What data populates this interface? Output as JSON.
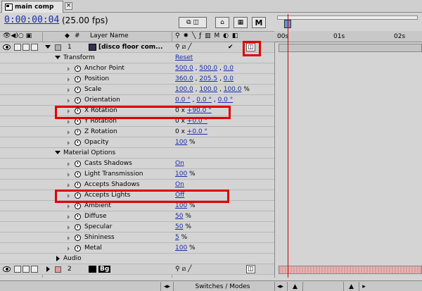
{
  "window": {
    "tab_title": "main comp",
    "close_glyph": "×"
  },
  "header": {
    "timecode": "0:00:00:04",
    "fps": "(25.00 fps)",
    "mode_button": "M"
  },
  "columns": {
    "hash": "#",
    "layer_name": "Layer Name"
  },
  "timeline": {
    "ticks": [
      "00s",
      "01s",
      "02s"
    ],
    "playhead_time": "0:00:00:04"
  },
  "layers": [
    {
      "num": "1",
      "name": "[disco floor com...",
      "label_color": "#b0b0b0",
      "bar_color": "#c4c4c4"
    },
    {
      "num": "2",
      "name": "Bg",
      "label_color": "#e89a9a",
      "bar_color": "#d9a0a0"
    }
  ],
  "transform": {
    "group": "Transform",
    "reset": "Reset",
    "props": [
      {
        "name": "Anchor Point",
        "value": [
          "500.0",
          " , ",
          "500.0",
          " , ",
          "0.0"
        ]
      },
      {
        "name": "Position",
        "value": [
          "360.0",
          " , ",
          "205.5",
          " , ",
          "0.0"
        ]
      },
      {
        "name": "Scale",
        "value": [
          "100.0",
          " , ",
          "100.0",
          " , ",
          "100.0",
          " %"
        ]
      },
      {
        "name": "Orientation",
        "value": [
          "0.0 °",
          " , ",
          "0.0 °",
          " , ",
          "0.0 °"
        ]
      },
      {
        "name": "X Rotation",
        "value": [
          "0 x ",
          "+90.0 °"
        ]
      },
      {
        "name": "Y Rotation",
        "value": [
          "0 x ",
          "+0.0 °"
        ]
      },
      {
        "name": "Z Rotation",
        "value": [
          "0 x ",
          "+0.0 °"
        ]
      },
      {
        "name": "Opacity",
        "value": [
          "100",
          " %"
        ]
      }
    ]
  },
  "material": {
    "group": "Material Options",
    "props": [
      {
        "name": "Casts Shadows",
        "value": [
          "On"
        ]
      },
      {
        "name": "Light Transmission",
        "value": [
          "100",
          " %"
        ]
      },
      {
        "name": "Accepts Shadows",
        "value": [
          "On"
        ]
      },
      {
        "name": "Accepts Lights",
        "value": [
          "Off"
        ]
      },
      {
        "name": "Ambient",
        "value": [
          "100",
          " %"
        ]
      },
      {
        "name": "Diffuse",
        "value": [
          "50",
          " %"
        ]
      },
      {
        "name": "Specular",
        "value": [
          "50",
          " %"
        ]
      },
      {
        "name": "Shininess",
        "value": [
          "5",
          " %"
        ]
      },
      {
        "name": "Metal",
        "value": [
          "100",
          " %"
        ]
      }
    ]
  },
  "audio": {
    "group": "Audio"
  },
  "footer": {
    "switches_modes": "Switches / Modes"
  },
  "colors": {
    "highlight": "#e00000",
    "playhead": "#c00000",
    "link": "#1a2ea8"
  }
}
